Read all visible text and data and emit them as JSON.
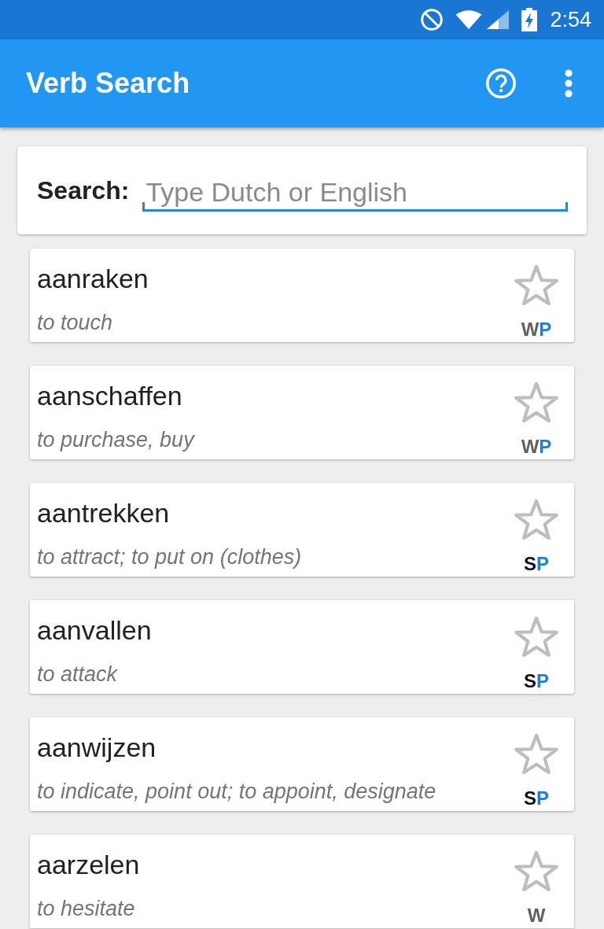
{
  "status_bar": {
    "time": "2:54"
  },
  "app_bar": {
    "title": "Verb Search"
  },
  "search": {
    "label": "Search:",
    "placeholder": "Type Dutch or English"
  },
  "verbs": [
    {
      "verb": "aanraken",
      "translation": "to touch",
      "starred": false,
      "tags": [
        {
          "text": "W",
          "color": "#616161"
        },
        {
          "text": "P",
          "color": "#1e7fd9"
        }
      ]
    },
    {
      "verb": "aanschaffen",
      "translation": "to purchase, buy",
      "starred": false,
      "tags": [
        {
          "text": "W",
          "color": "#616161"
        },
        {
          "text": "P",
          "color": "#1e7fd9"
        }
      ]
    },
    {
      "verb": "aantrekken",
      "translation": "to attract; to put on (clothes)",
      "starred": false,
      "tags": [
        {
          "text": "S",
          "color": "#111111"
        },
        {
          "text": "P",
          "color": "#1e7fd9"
        }
      ]
    },
    {
      "verb": "aanvallen",
      "translation": "to attack",
      "starred": false,
      "tags": [
        {
          "text": "S",
          "color": "#111111"
        },
        {
          "text": "P",
          "color": "#1e7fd9"
        }
      ]
    },
    {
      "verb": "aanwijzen",
      "translation": "to indicate, point out; to appoint, designate",
      "starred": false,
      "tags": [
        {
          "text": "S",
          "color": "#111111"
        },
        {
          "text": "P",
          "color": "#1e7fd9"
        }
      ]
    },
    {
      "verb": "aarzelen",
      "translation": "to hesitate",
      "starred": false,
      "tags": [
        {
          "text": "W",
          "color": "#616161"
        }
      ]
    }
  ]
}
